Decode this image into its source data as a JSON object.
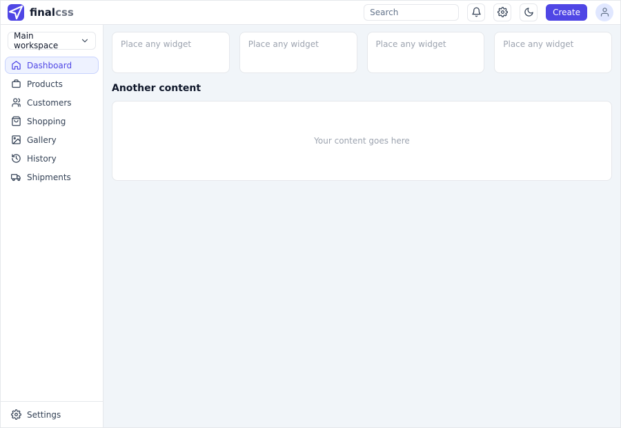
{
  "brand": {
    "name_primary": "final",
    "name_secondary": "css"
  },
  "header": {
    "search_placeholder": "Search",
    "create_label": "Create"
  },
  "sidebar": {
    "workspace_label": "Main workspace",
    "items": [
      {
        "label": "Dashboard"
      },
      {
        "label": "Products"
      },
      {
        "label": "Customers"
      },
      {
        "label": "Shopping"
      },
      {
        "label": "Gallery"
      },
      {
        "label": "History"
      },
      {
        "label": "Shipments"
      }
    ],
    "settings_label": "Settings"
  },
  "main": {
    "widget_placeholder": "Place any widget",
    "section_title": "Another content",
    "panel_placeholder": "Your content goes here"
  }
}
